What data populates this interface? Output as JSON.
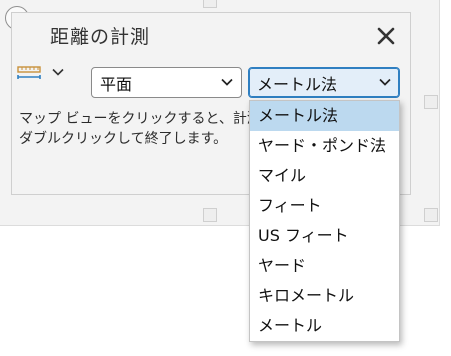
{
  "panel": {
    "title": "距離の計測",
    "close_icon": "close-icon",
    "collapse_icon": "chevron-up-icon",
    "unit_tool_icon": "ruler-icon"
  },
  "mode_select": {
    "value": "平面"
  },
  "unit_select": {
    "value": "メートル法"
  },
  "instructions": [
    "マップ ビューをクリックすると、計測",
    "ダブルクリックして終了します。"
  ],
  "unit_options": [
    {
      "label": "メートル法",
      "selected": true
    },
    {
      "label": "ヤード・ポンド法",
      "selected": false
    },
    {
      "label": "マイル",
      "selected": false
    },
    {
      "label": "フィート",
      "selected": false
    },
    {
      "label": "US フィート",
      "selected": false
    },
    {
      "label": "ヤード",
      "selected": false
    },
    {
      "label": "キロメートル",
      "selected": false
    },
    {
      "label": "メートル",
      "selected": false
    }
  ],
  "colors": {
    "accent": "#2f7fc1",
    "selected_row": "#bcd9ef",
    "ruler": "#c8913a"
  }
}
